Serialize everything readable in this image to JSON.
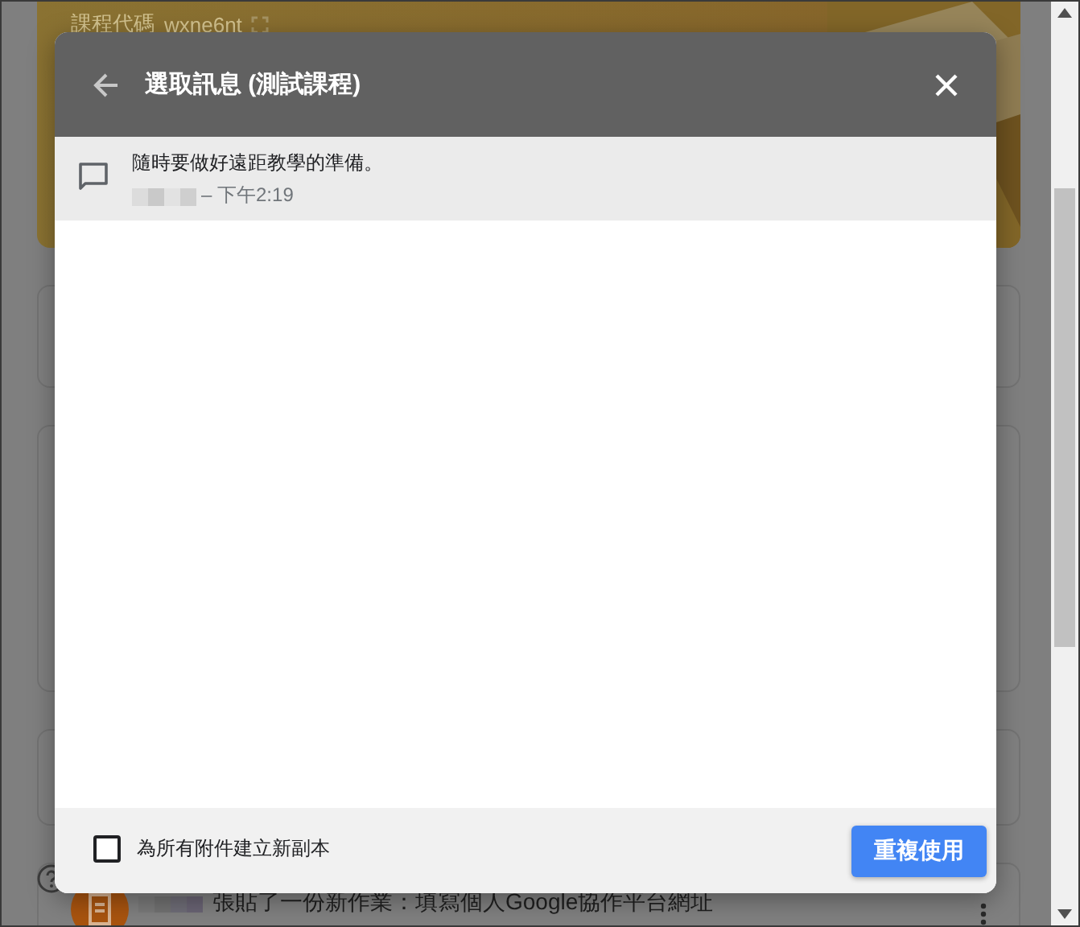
{
  "background": {
    "course_code_label": "課程代碼",
    "course_code": "wxne6nt",
    "post_text": "張貼了一份新作業：填寫個人Google協作平台網址"
  },
  "dialog": {
    "title": "選取訊息 (測試課程)",
    "messages": [
      {
        "text": "隨時要做好遠距教學的準備。",
        "time": "– 下午2:19",
        "selected": true
      }
    ],
    "copy_attachments": {
      "label": "為所有附件建立新副本",
      "checked": false
    },
    "reuse_button": "重複使用"
  }
}
